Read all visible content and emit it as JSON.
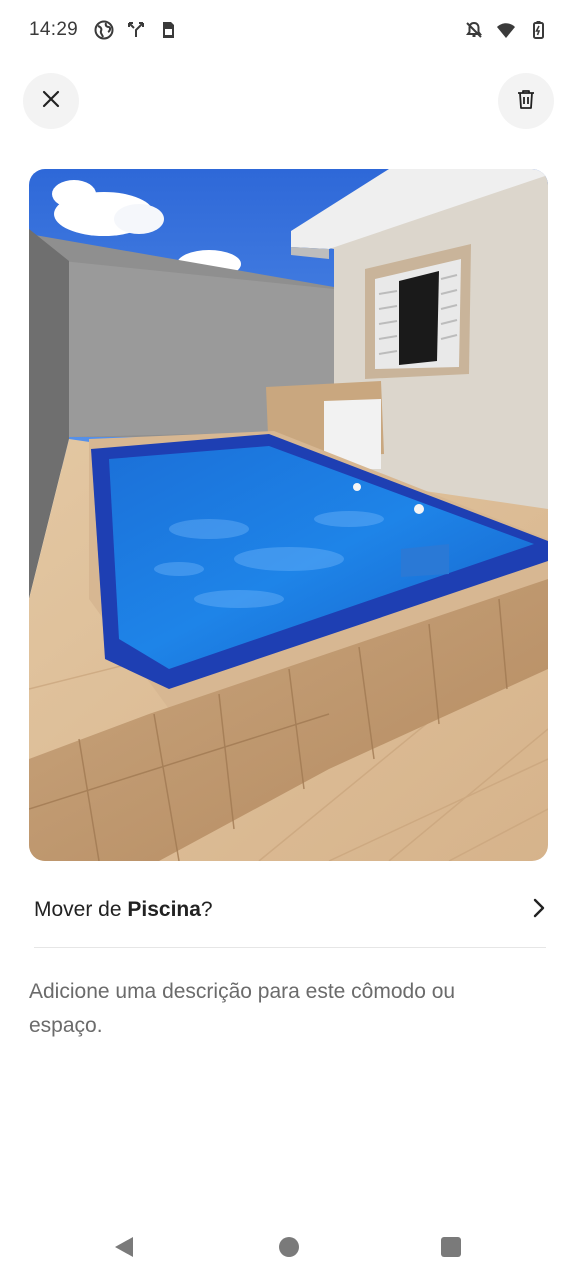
{
  "status_bar": {
    "time": "14:29",
    "left_icons": [
      "globe-icon",
      "call-split-icon",
      "sim-card-icon"
    ],
    "right_icons": [
      "notifications-off-icon",
      "wifi-icon",
      "battery-icon"
    ]
  },
  "toolbar": {
    "close_icon": "close-icon",
    "delete_icon": "trash-icon"
  },
  "photo": {
    "subject": "pool-photo"
  },
  "move_row": {
    "prefix": "Mover de ",
    "room": "Piscina",
    "suffix": "?",
    "chevron_icon": "chevron-right-icon"
  },
  "description": {
    "placeholder": "Adicione uma descrição para este cômodo ou espaço."
  },
  "nav_bar": {
    "icons": [
      "back-icon",
      "home-icon",
      "recents-icon"
    ]
  }
}
